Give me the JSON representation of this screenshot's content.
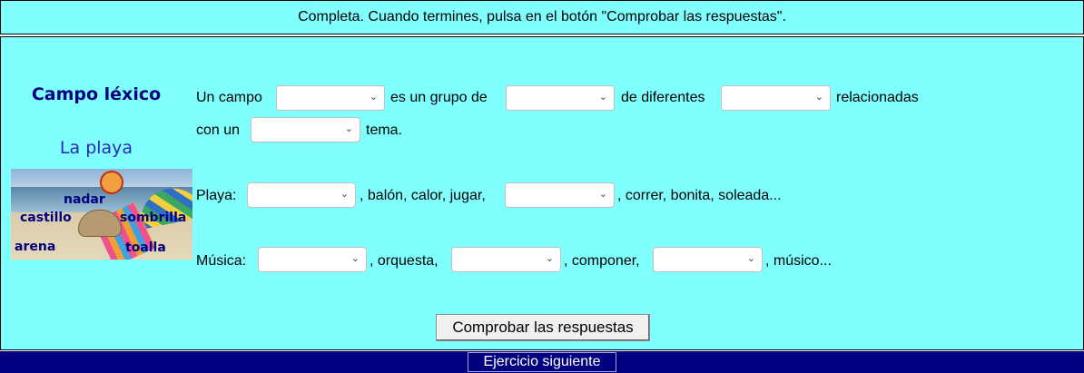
{
  "instructions": "Completa. Cuando termines, pulsa en el botón \"Comprobar las respuestas\".",
  "sidebar": {
    "title": "Campo léxico",
    "subtitle": "La playa",
    "image_labels": [
      "nadar",
      "castillo",
      "sombrilla",
      "arena",
      "toalla"
    ]
  },
  "exercise": {
    "line1": {
      "t1": "Un campo",
      "t2": "es un grupo de",
      "t3": "de diferentes",
      "t4": "relacionadas"
    },
    "line2": {
      "t1": "con un",
      "t2": "tema."
    },
    "playa": {
      "t1": "Playa:",
      "t2": ", balón, calor, jugar,",
      "t3": ", correr, bonita, soleada..."
    },
    "musica": {
      "t1": "Música:",
      "t2": ", orquesta,",
      "t3": ", componer,",
      "t4": ", músico..."
    },
    "select_values": [
      "",
      "",
      "",
      "",
      "",
      "",
      "",
      "",
      ""
    ]
  },
  "buttons": {
    "check": "Comprobar las respuestas",
    "next": "Ejercicio siguiente"
  },
  "colors": {
    "background": "#80ffff",
    "footer": "#000080",
    "title": "#000080"
  }
}
